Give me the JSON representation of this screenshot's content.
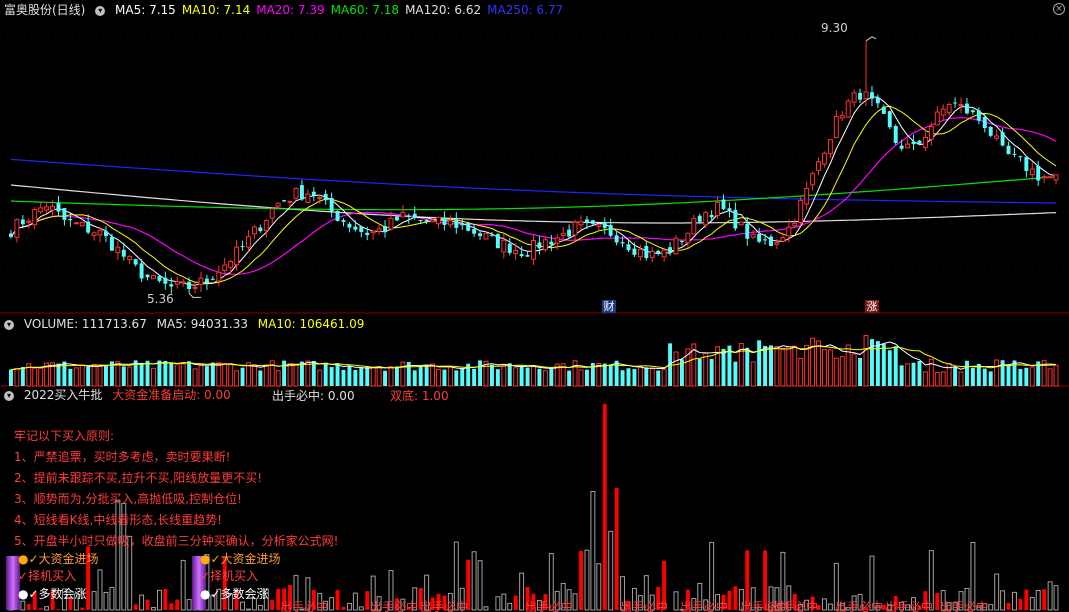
{
  "colors": {
    "up": "#ff3232",
    "down": "#54fcfc",
    "ma5": "#ffffff",
    "ma10": "#ffff00",
    "ma20": "#ff00ff",
    "ma60": "#00e600",
    "ma120": "#e0e0e0",
    "ma250": "#2323ff",
    "grid": "#8b0000",
    "text_red": "#ff3b3b",
    "text_orange": "#ff9a3a"
  },
  "price_panel": {
    "title": "富奥股份(日线)",
    "indicators": [
      {
        "label": "MA5: 7.15",
        "color": "#ffffff"
      },
      {
        "label": "MA10: 7.14",
        "color": "#ffff00"
      },
      {
        "label": "MA20: 7.39",
        "color": "#ff00ff"
      },
      {
        "label": "MA60: 7.18",
        "color": "#00e600"
      },
      {
        "label": "MA120: 6.62",
        "color": "#e0e0e0"
      },
      {
        "label": "MA250: 6.77",
        "color": "#3232ff"
      }
    ],
    "high_label": "9.30",
    "low_label": "5.36",
    "marker_cai": "财",
    "marker_zhang": "涨"
  },
  "volume_panel": {
    "title": "VOLUME: 111713.67",
    "ma5": "MA5: 94031.33",
    "ma10": "MA10: 106461.09"
  },
  "indicator_panel": {
    "title": "2022买入牛批",
    "fund_start": "大资金准备启动: 0.00",
    "must_buy": "出手必中: 0.00",
    "double_bottom": "双底: 1.00",
    "rules_title": "牢记以下买入原则:",
    "rules": [
      "1、严禁追票，买时多考虑，卖时要果断!",
      "2、提前未跟踪不买,拉升不买,阳线放量更不买!",
      "3、顺势而为,分批买入,高抛低吸,控制仓位!",
      "4、短线看K线,中线看形态,长线重趋势!",
      "5、开盘半小时只做吸，收盘前三分钟买确认，分析家公式网!"
    ],
    "signal_groups": [
      {
        "a": "大资金进场",
        "b": "择机买入",
        "c": "多数会涨"
      },
      {
        "a": "大资金进场",
        "b": "择机买入",
        "c": "多数会涨"
      }
    ],
    "bottom_label": "出手必中"
  },
  "chart_data": {
    "type": "candlestick",
    "title": "富奥股份(日线)",
    "price_high": 9.3,
    "price_low": 5.36,
    "moving_averages": {
      "MA5": 7.15,
      "MA10": 7.14,
      "MA20": 7.39,
      "MA60": 7.18,
      "MA120": 6.62,
      "MA250": 6.77
    },
    "volume": {
      "VOLUME": 111713.67,
      "MA5": 94031.33,
      "MA10": 106461.09
    },
    "indicator": {
      "大资金准备启动": 0.0,
      "出手必中": 0.0,
      "双底": 1.0
    },
    "close_path": [
      6.35,
      6.55,
      6.75,
      6.5,
      6.4,
      6.3,
      6.05,
      5.75,
      5.55,
      5.45,
      5.45,
      5.55,
      5.8,
      6.05,
      6.4,
      6.75,
      6.9,
      6.95,
      6.65,
      6.45,
      6.3,
      6.35,
      6.55,
      6.5,
      6.45,
      6.45,
      6.35,
      6.2,
      6.1,
      6.0,
      6.15,
      6.25,
      6.4,
      6.35,
      6.3,
      6.1,
      5.95,
      6.0,
      6.25,
      6.6,
      6.7,
      6.45,
      6.15,
      6.15,
      6.4,
      7.0,
      7.7,
      8.25,
      8.5,
      8.2,
      7.7,
      7.6,
      8.0,
      8.35,
      8.2,
      8.0,
      7.55,
      7.4,
      7.2,
      7.15
    ]
  }
}
